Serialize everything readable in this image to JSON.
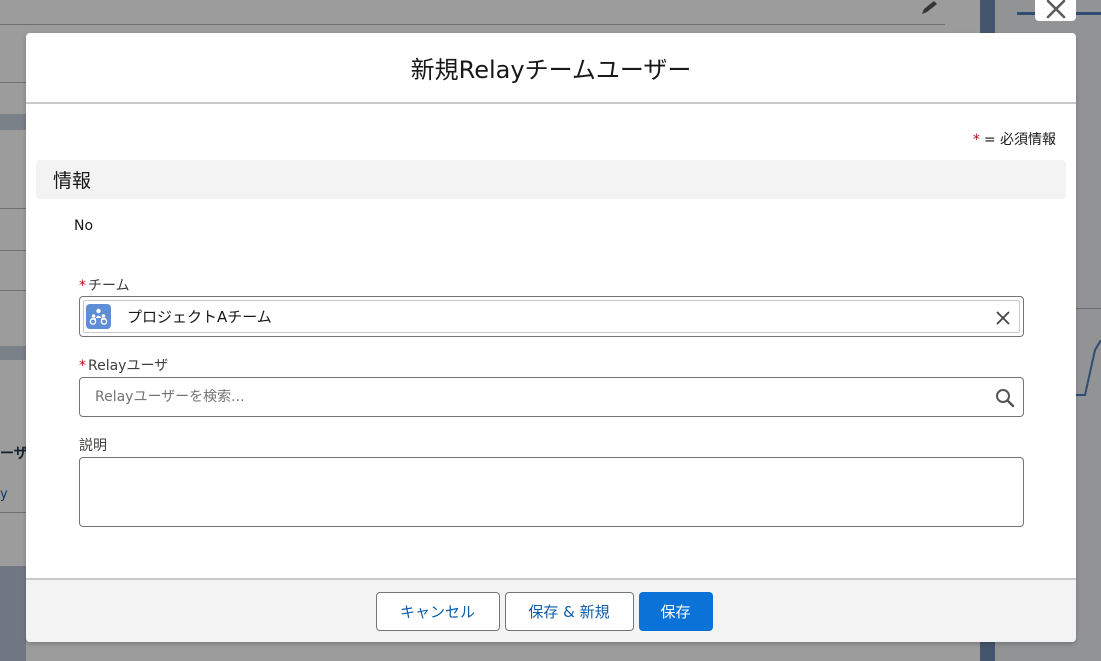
{
  "background": {
    "partial_label": "ーザー",
    "partial_link": "y"
  },
  "modal": {
    "title": "新規Relayチームユーザー",
    "required_note": "= 必須情報",
    "required_marker": "*",
    "section_title": "情報",
    "record_no_label": "No",
    "fields": {
      "team": {
        "label": "チーム",
        "value": "プロジェクトAチーム",
        "icon": "team-icon"
      },
      "relay_user": {
        "label": "Relayユーザ",
        "value": "",
        "placeholder": "Relayユーザーを検索...",
        "icon": "search-icon"
      },
      "description": {
        "label": "説明",
        "value": ""
      }
    },
    "buttons": {
      "cancel": "キャンセル",
      "save_and_new": "保存 & 新規",
      "save": "保存"
    }
  },
  "colors": {
    "brand": "#0b72d7",
    "required": "#ba0517",
    "link": "#0b5cab"
  }
}
